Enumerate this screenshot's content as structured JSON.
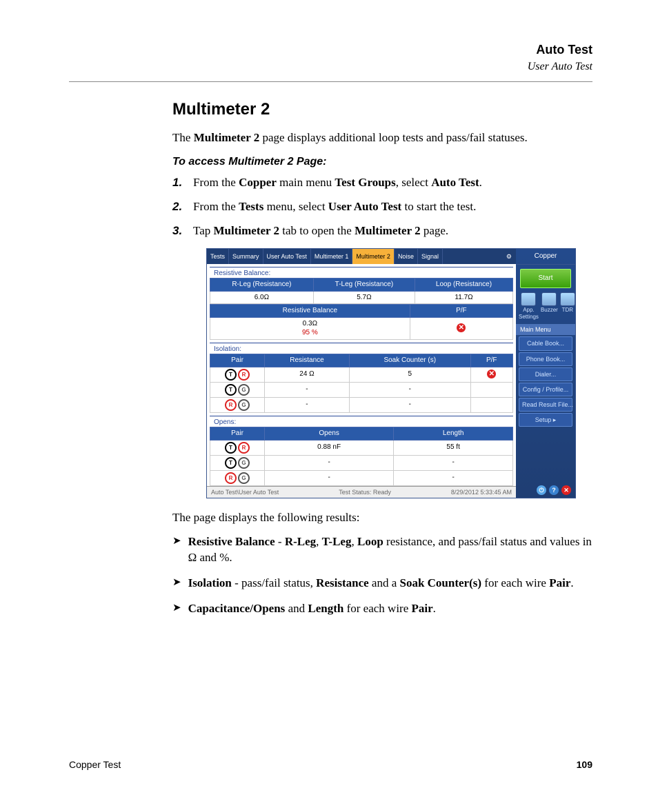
{
  "header": {
    "title": "Auto Test",
    "subtitle": "User Auto Test"
  },
  "section_heading": "Multimeter 2",
  "intro": {
    "pre": "The ",
    "b1": "Multimeter 2",
    "post": " page displays additional loop tests and pass/fail statuses."
  },
  "subhead": "To access Multimeter 2 Page:",
  "steps": [
    {
      "num": "1.",
      "parts": [
        "From the ",
        "Copper",
        " main menu ",
        "Test Groups",
        ", select ",
        "Auto Test",
        "."
      ]
    },
    {
      "num": "2.",
      "parts": [
        "From the ",
        "Tests",
        " menu, select ",
        "User Auto Test",
        " to start the test."
      ]
    },
    {
      "num": "3.",
      "parts": [
        "Tap ",
        "Multimeter 2",
        " tab to open the ",
        "Multimeter 2",
        " page."
      ]
    }
  ],
  "screenshot": {
    "tabs": [
      "Tests",
      "Summary",
      "User Auto Test",
      "Multimeter 1",
      "Multimeter 2",
      "Noise",
      "Signal"
    ],
    "active_tab": "Multimeter 2",
    "side_title": "Copper",
    "start_label": "Start",
    "side_icons": [
      {
        "name": "app-settings-icon",
        "label": "App. Settings"
      },
      {
        "name": "buzzer-icon",
        "label": "Buzzer"
      },
      {
        "name": "tdr-icon",
        "label": "TDR"
      }
    ],
    "main_menu_label": "Main Menu",
    "menu_items": [
      "Cable Book...",
      "Phone Book...",
      "Dialer...",
      "Config / Profile...",
      "Read Result File...",
      "Setup        ▸"
    ],
    "resistive": {
      "title": "Resistive Balance:",
      "top_headers": [
        "R-Leg (Resistance)",
        "T-Leg (Resistance)",
        "Loop (Resistance)"
      ],
      "top_values": [
        "6.0Ω",
        "5.7Ω",
        "11.7Ω"
      ],
      "mid_headers": [
        "Resistive Balance",
        "P/F"
      ],
      "bal_value": "0.3Ω",
      "bal_percent": "95 %",
      "pf_fail": true
    },
    "isolation": {
      "title": "Isolation:",
      "headers": [
        "Pair",
        "Resistance",
        "Soak Counter (s)",
        "P/F"
      ],
      "rows": [
        {
          "pair": [
            "T",
            "R"
          ],
          "resistance": "24 Ω",
          "soak": "5",
          "fail": true,
          "red": true
        },
        {
          "pair": [
            "T",
            "G"
          ],
          "resistance": "-",
          "soak": "-",
          "fail": false
        },
        {
          "pair": [
            "R",
            "G"
          ],
          "resistance": "-",
          "soak": "-",
          "fail": false
        }
      ]
    },
    "opens": {
      "title": "Opens:",
      "headers": [
        "Pair",
        "Opens",
        "Length"
      ],
      "rows": [
        {
          "pair": [
            "T",
            "R"
          ],
          "opens": "0.88 nF",
          "length": "55 ft",
          "red_second": true
        },
        {
          "pair": [
            "T",
            "G"
          ],
          "opens": "-",
          "length": "-"
        },
        {
          "pair": [
            "R",
            "G"
          ],
          "opens": "-",
          "length": "-"
        }
      ]
    },
    "status": {
      "left": "Auto Test\\User Auto Test",
      "center": "Test Status: Ready",
      "right": "8/29/2012 5:33:45 AM"
    }
  },
  "results_intro": "The page displays the following results:",
  "bullets": [
    {
      "html": "<span class='b'>Resistive Balance</span> - <span class='b'>R-Leg</span>, <span class='b'>T-Leg</span>, <span class='b'>Loop</span> resistance, and pass/fail status and values in Ω and %."
    },
    {
      "html": "<span class='b'>Isolation</span> - pass/fail status, <span class='b'>Resistance</span> and a <span class='b'>Soak Counter(s)</span> for each wire <span class='b'>Pair</span>."
    },
    {
      "html": "<span class='b'>Capacitance/Opens</span> and <span class='b'>Length</span> for each wire <span class='b'>Pair</span>."
    }
  ],
  "footer": {
    "left": "Copper Test",
    "right": "109"
  }
}
